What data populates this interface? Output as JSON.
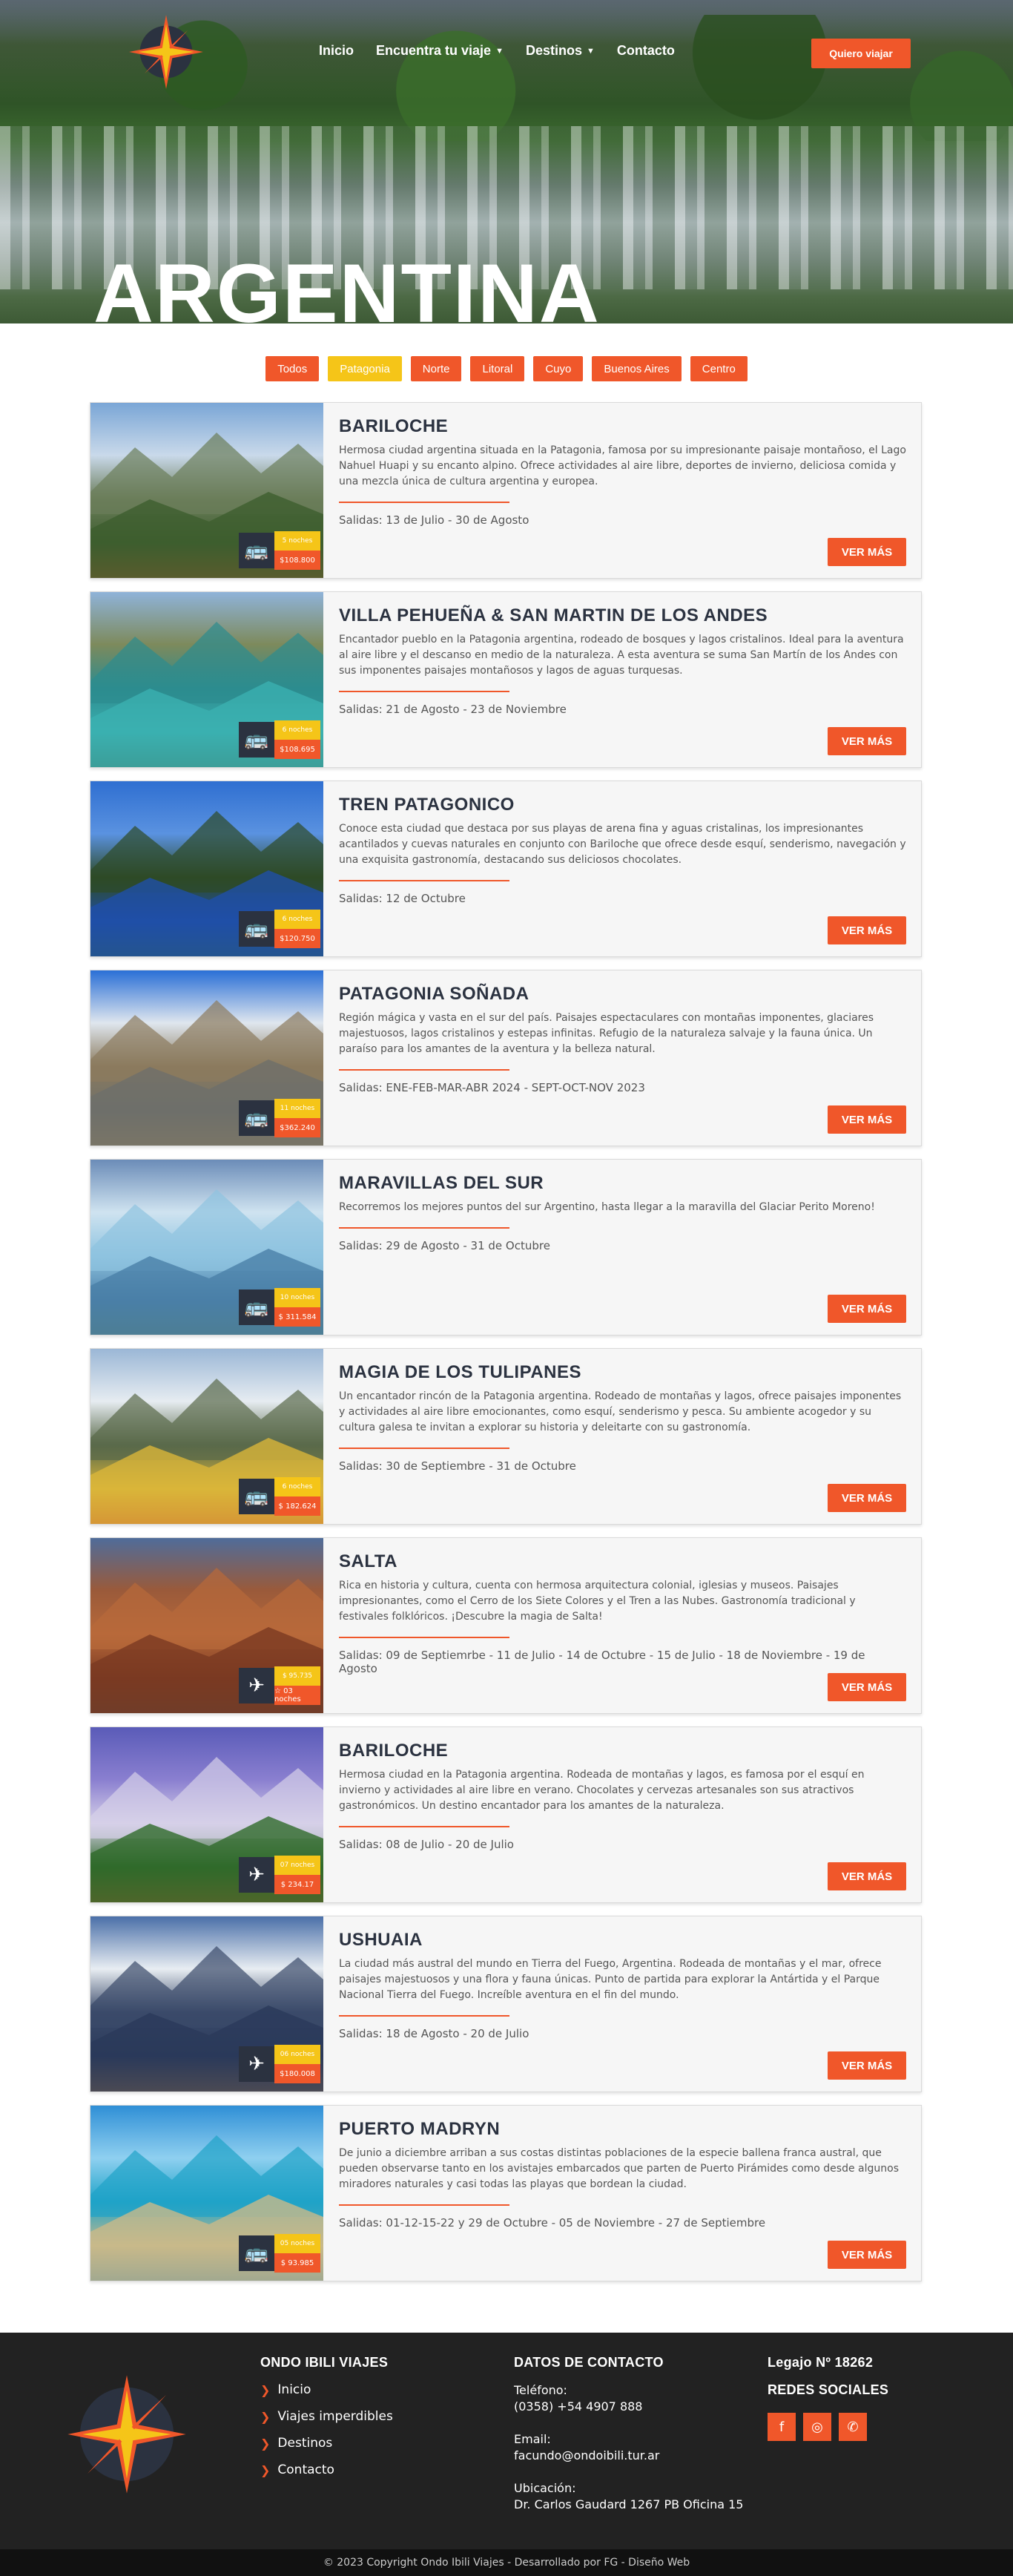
{
  "nav": {
    "items": [
      {
        "label": "Inicio",
        "dropdown": false
      },
      {
        "label": "Encuentra tu viaje",
        "dropdown": true
      },
      {
        "label": "Destinos",
        "dropdown": true
      },
      {
        "label": "Contacto",
        "dropdown": false
      }
    ],
    "cta": "Quiero viajar"
  },
  "hero": {
    "title": "ARGENTINA"
  },
  "filters": [
    "Todos",
    "Patagonia",
    "Norte",
    "Litoral",
    "Cuyo",
    "Buenos Aires",
    "Centro"
  ],
  "active_filter": "Patagonia",
  "cards": [
    {
      "title": "BARILOCHE",
      "desc": "Hermosa ciudad argentina situada en la Patagonia, famosa por su impresionante paisaje montañoso, el Lago Nahuel Huapi y su encanto alpino. Ofrece actividades al aire libre, deportes de invierno, deliciosa comida y una mezcla única de cultura argentina y europea.",
      "dates": "Salidas: 13 de Julio - 30 de Agosto",
      "transport": "bus-icon",
      "top": "5 noches",
      "price": "$108.800",
      "more": "VER MÁS",
      "palette": [
        "#7aa6d6",
        "#c9d9ea",
        "#6b7d5a",
        "#3d5e2e",
        "#c2542a"
      ]
    },
    {
      "title": "VILLA PEHUEÑA & SAN MARTIN DE LOS ANDES",
      "desc": "Encantador pueblo en la Patagonia argentina, rodeado de bosques y lagos cristalinos. Ideal para la aventura al aire libre y el descanso en medio de la naturaleza. A esta aventura se suma San Martín de los Andes con sus imponentes paisajes montañosos y lagos de aguas turquesas.",
      "dates": "Salidas: 21 de Agosto - 23 de Noviembre",
      "transport": "bus-icon",
      "top": "6 noches",
      "price": "$108.695",
      "more": "VER MÁS",
      "palette": [
        "#8fb3d9",
        "#7d8a5c",
        "#2c8c8f",
        "#3bb0b0",
        "#40533a"
      ]
    },
    {
      "title": "TREN PATAGONICO",
      "desc": "Conoce esta ciudad que destaca por sus playas de arena fina y aguas cristalinas, los impresionantes acantilados y cuevas naturales en conjunto con Bariloche que ofrece desde esquí, senderismo, navegación y una exquisita gastronomía, destacando sus deliciosos chocolates.",
      "dates": "Salidas: 12 de Octubre",
      "transport": "bus-icon",
      "top": "6 noches",
      "price": "$120.750",
      "more": "VER MÁS",
      "palette": [
        "#2f6fd1",
        "#5a92e0",
        "#2e4a26",
        "#1f4fa8",
        "#3c6b2e"
      ]
    },
    {
      "title": "PATAGONIA SOÑADA",
      "desc": "Región mágica y vasta en el sur del país. Paisajes espectaculares con montañas imponentes, glaciares majestuosos, lagos cristalinos y estepas infinitas. Refugio de la naturaleza salvaje y la fauna única. Un paraíso para los amantes de la aventura y la belleza natural.",
      "dates": "Salidas: ENE-FEB-MAR-ABR 2024 - SEPT-OCT-NOV 2023",
      "transport": "bus-icon",
      "top": "11 noches",
      "price": "$362.240",
      "more": "VER MÁS",
      "palette": [
        "#2a6fd6",
        "#dfe6ee",
        "#8b7b5e",
        "#6e6f6a",
        "#a58b5a"
      ]
    },
    {
      "title": "MARAVILLAS DEL SUR",
      "desc": "Recorremos los mejores puntos del sur Argentino, hasta llegar a la maravilla del Glaciar Perito Moreno!",
      "dates": "Salidas: 29 de Agosto - 31 de Octubre",
      "transport": "bus-icon",
      "top": "10 noches",
      "price": "$ 311.584",
      "more": "VER MÁS",
      "palette": [
        "#6b8cb8",
        "#cfe3f0",
        "#8ec3e0",
        "#4a7fa8",
        "#5b7a4a"
      ]
    },
    {
      "title": "MAGIA DE LOS TULIPANES",
      "desc": "Un encantador rincón de la Patagonia argentina. Rodeado de montañas y lagos, ofrece paisajes imponentes y actividades al aire libre emocionantes, como esquí, senderismo y pesca. Su ambiente acogedor y su cultura galesa te invitan a explorar su historia y deleitarte con su gastronomía.",
      "dates": "Salidas: 30 de Septiembre - 31 de Octubre",
      "transport": "bus-icon",
      "top": "6 noches",
      "price": "$ 182.624",
      "more": "VER MÁS",
      "palette": [
        "#9bb7d6",
        "#e6ecf1",
        "#5a6a4a",
        "#d9b53a",
        "#c4202a"
      ]
    },
    {
      "title": "SALTA",
      "desc": "Rica en historia y cultura, cuenta con hermosa arquitectura colonial, iglesias y museos. Paisajes impresionantes, como el Cerro de los Siete Colores y el Tren a las Nubes. Gastronomía tradicional y festivales folklóricos. ¡Descubre la magia de Salta!",
      "dates": "Salidas: 09 de Septiemrbe - 11 de Julio - 14 de Octubre - 15 de Julio - 18 de Noviembre - 19 de Agosto",
      "transport": "plane-icon",
      "top": "$ 95.735",
      "price": "☆ 03 noches",
      "more": "VER MÁS",
      "palette": [
        "#4f6c9a",
        "#9a5a3a",
        "#b8693a",
        "#7a3a22",
        "#4a4a44"
      ]
    },
    {
      "title": "BARILOCHE",
      "desc": "Hermosa ciudad en la Patagonia argentina. Rodeada de montañas y lagos, es famosa por el esquí en invierno y actividades al aire libre en verano. Chocolates y cervezas artesanales son sus atractivos gastronómicos. Un destino encantador para los amantes de la naturaleza.",
      "dates": "Salidas: 08 de Julio - 20 de Julio",
      "transport": "plane-icon",
      "top": "07 noches",
      "price": "$ 234.17",
      "more": "VER MÁS",
      "palette": [
        "#5a5bb8",
        "#8a7fd0",
        "#d6d0e8",
        "#2f6a2a",
        "#c2542a"
      ]
    },
    {
      "title": "USHUAIA",
      "desc": "La ciudad más austral del mundo en Tierra del Fuego, Argentina. Rodeada de montañas y el mar, ofrece paisajes majestuosos y una flora y fauna únicas. Punto de partida para explorar la Antártida y el Parque Nacional Tierra del Fuego. Increíble aventura en el fin del mundo.",
      "dates": "Salidas: 18 de Agosto - 20 de Julio",
      "transport": "plane-icon",
      "top": "06 noches",
      "price": "$180.008",
      "more": "VER MÁS",
      "palette": [
        "#4a6fa8",
        "#e8edf2",
        "#3a4a6a",
        "#2b3a5a",
        "#c98a3a"
      ]
    },
    {
      "title": "PUERTO MADRYN",
      "desc": "De junio a diciembre arriban a sus costas distintas poblaciones de la especie ballena franca austral, que pueden observarse tanto en los avistajes embarcados que parten de Puerto Pirámides como desde algunos miradores naturales y casi todas las playas que bordean la ciudad.",
      "dates": "Salidas: 01-12-15-22 y 29 de Octubre - 05 de Noviembre - 27 de Septiembre",
      "transport": "bus-icon",
      "top": "05 noches",
      "price": "$ 93.985",
      "more": "VER MÁS",
      "palette": [
        "#2f8fd6",
        "#8fd0f0",
        "#1fa3c8",
        "#c8b98a",
        "#0c6aa8"
      ]
    }
  ],
  "footer": {
    "brand_title": "ONDO IBILI VIAJES",
    "links": [
      "Inicio",
      "Viajes imperdibles",
      "Destinos",
      "Contacto"
    ],
    "contact_title": "DATOS DE CONTACTO",
    "phone_label": "Teléfono:",
    "phone": "(0358) +54 4907 888",
    "email_label": "Email:",
    "email": "facundo@ondoibili.tur.ar",
    "address_label": "Ubicación:",
    "address": "Dr. Carlos Gaudard 1267 PB Oficina 15",
    "legajo": "Legajo Nº 18262",
    "social_title": "REDES SOCIALES",
    "social": [
      "facebook-icon",
      "instagram-icon",
      "whatsapp-icon"
    ],
    "copyright": "© 2023 Copyright Ondo Ibili Viajes - Desarrollado por FG - Diseño Web"
  },
  "colors": {
    "accent": "#f0572a",
    "active": "#f5c518",
    "dark": "#2b3240",
    "footer": "#222222"
  }
}
